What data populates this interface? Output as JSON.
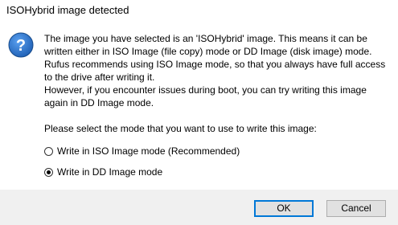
{
  "window": {
    "title": "ISOHybrid image detected"
  },
  "icon": {
    "name": "question-icon",
    "color": "#1e5fb4"
  },
  "message": {
    "lines": [
      "The image you have selected is an 'ISOHybrid' image. This means it can be written either in ISO Image (file copy) mode or DD Image (disk image) mode. Rufus recommends using ISO Image mode, so that you always have full access to the drive after writing it.",
      "However, if you encounter issues during boot, you can try writing this image again in DD Image mode."
    ]
  },
  "prompt": "Please select the mode that you want to use to write this image:",
  "options": [
    {
      "label": "Write in ISO Image mode (Recommended)",
      "selected": false
    },
    {
      "label": "Write in DD Image mode",
      "selected": true
    }
  ],
  "buttons": {
    "ok": "OK",
    "cancel": "Cancel"
  },
  "colors": {
    "footer_bg": "#f0f0f0",
    "focus_border": "#0078d7"
  }
}
